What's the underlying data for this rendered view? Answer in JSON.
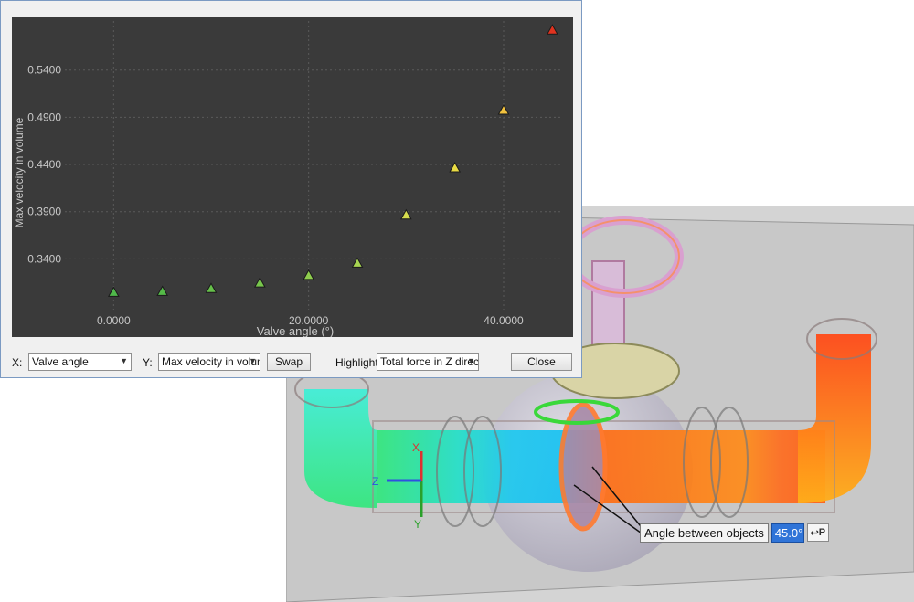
{
  "chart_data": {
    "type": "scatter",
    "xlabel": "Valve angle (°)",
    "ylabel": "Max velocity in volume",
    "xlim": [
      -5,
      46
    ],
    "ylim": [
      0.29,
      0.592
    ],
    "xticks": [
      0,
      20,
      40
    ],
    "xtick_labels": [
      "0.0000",
      "20.0000",
      "40.0000"
    ],
    "yticks": [
      0.34,
      0.39,
      0.44,
      0.49,
      0.54
    ],
    "ytick_labels": [
      "0.3400",
      "0.3900",
      "0.4400",
      "0.4900",
      "0.5400"
    ],
    "grid": true,
    "x": [
      0,
      5,
      10,
      15,
      20,
      25,
      30,
      35,
      40,
      45
    ],
    "y": [
      0.3045,
      0.3055,
      0.3085,
      0.3145,
      0.3225,
      0.3355,
      0.3865,
      0.4365,
      0.4975,
      0.5825
    ],
    "point_colors": [
      "#4fb84a",
      "#55ba48",
      "#66c04a",
      "#78c64c",
      "#8fcd4e",
      "#a7d452",
      "#d6dc4e",
      "#e9db44",
      "#f2c23e",
      "#e0331f"
    ],
    "background": "#3a3a3a",
    "gridline_color": "#5a5a5a"
  },
  "controls": {
    "x_label": "X:",
    "x_value": "Valve angle",
    "y_label": "Y:",
    "y_value": "Max velocity in volun",
    "swap_label": "Swap",
    "highlight_label": "Highlight:",
    "highlight_value": "Total force in Z direc",
    "close_label": "Close"
  },
  "viewport": {
    "angle_label": "Angle between objects",
    "angle_value": "45.0°",
    "pin_label": "P",
    "axis_x": "X",
    "axis_y": "Y",
    "axis_z": "Z"
  }
}
